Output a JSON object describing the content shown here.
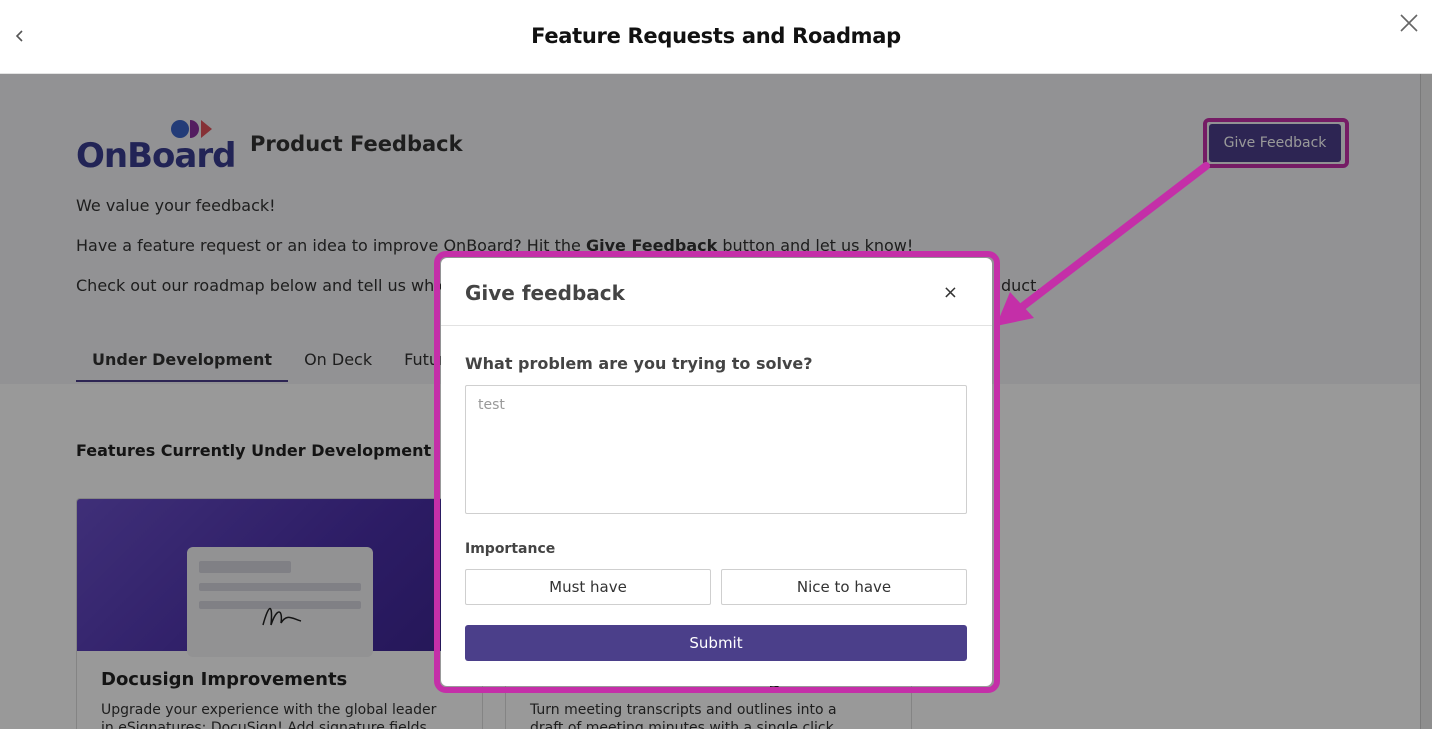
{
  "header": {
    "title": "Feature Requests and Roadmap",
    "back_icon": "chevron-left-icon",
    "close_icon": "close-icon"
  },
  "page": {
    "logo_text": "OnBoard",
    "title": "Product Feedback",
    "give_feedback_label": "Give Feedback",
    "intro_line1": "We value your feedback!",
    "intro_line2_pre": "Have a feature request or an idea to improve OnBoard? Hit the ",
    "intro_line2_bold": "Give Feedback",
    "intro_line2_post": " button and let us know!",
    "intro_line3_pre": "Check out our roadmap below and tell us which ",
    "intro_line3_post": "duct.",
    "tabs": [
      "Under Development",
      "On Deck",
      "Future I"
    ],
    "section_title": "Features Currently Under Development",
    "cards": [
      {
        "title": "Docusign Improvements",
        "body": "Upgrade your experience with the global leader in eSignatures: DocuSign! Add signature fields"
      },
      {
        "title": "g",
        "body": "Turn meeting transcripts and outlines into a draft of meeting minutes with a single click. After"
      }
    ]
  },
  "modal": {
    "title": "Give feedback",
    "close_glyph": "×",
    "question_label": "What problem are you trying to solve?",
    "question_value": "test",
    "importance_label": "Importance",
    "options": [
      "Must have",
      "Nice to have"
    ],
    "submit_label": "Submit"
  },
  "colors": {
    "accent": "#4b3f8a",
    "highlight": "#c42fa8"
  }
}
